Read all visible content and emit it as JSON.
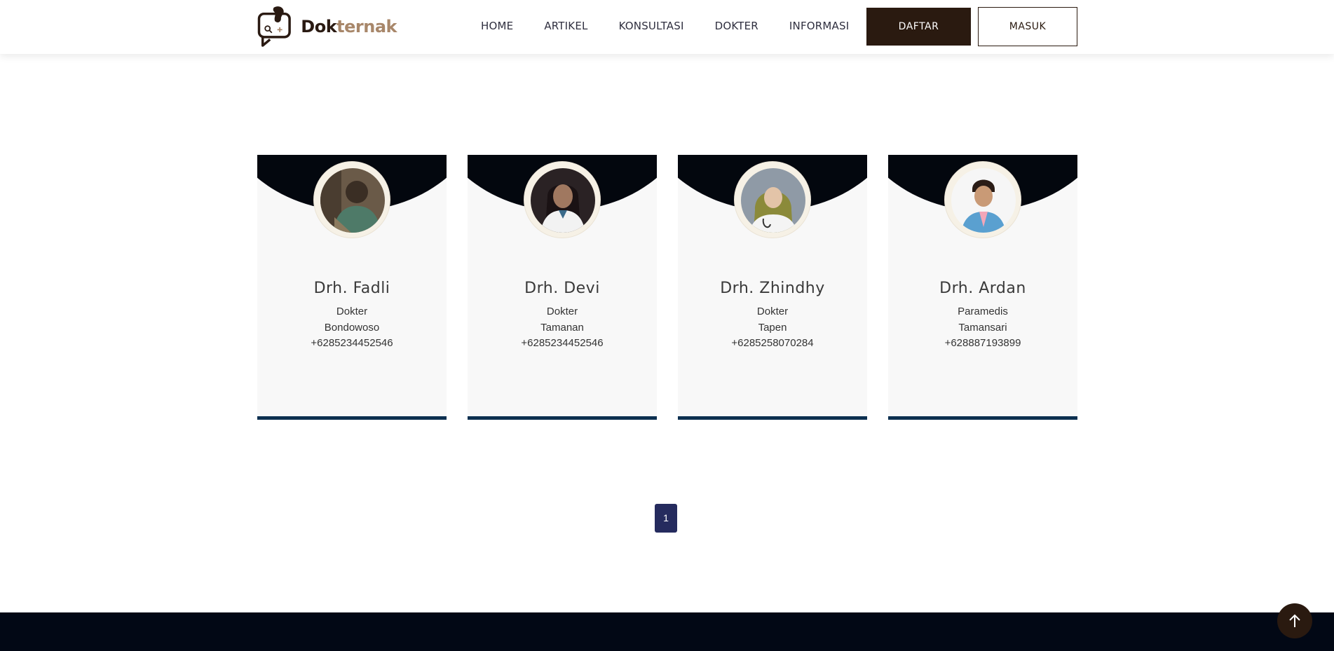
{
  "brand": {
    "part1": "Dok",
    "part2": "ternak"
  },
  "nav": {
    "items": [
      "HOME",
      "ARTIKEL",
      "KONSULTASI",
      "DOKTER",
      "INFORMASI"
    ]
  },
  "auth": {
    "register_label": "DAFTAR",
    "login_label": "MASUK"
  },
  "doctors": [
    {
      "name": "Drh. Fadli",
      "role": "Dokter",
      "city": "Bondowoso",
      "phone": "+6285234452546"
    },
    {
      "name": "Drh. Devi",
      "role": "Dokter",
      "city": "Tamanan",
      "phone": "+6285234452546"
    },
    {
      "name": "Drh. Zhindhy",
      "role": "Dokter",
      "city": "Tapen",
      "phone": "+6285258070284"
    },
    {
      "name": "Drh. Ardan",
      "role": "Paramedis",
      "city": "Tamansari",
      "phone": "+628887193899"
    }
  ],
  "pagination": {
    "current": "1"
  },
  "icons": {
    "logo": "dokternak-logo",
    "scroll_top": "arrow-up-icon"
  },
  "colors": {
    "primary": "#2a1a10",
    "accent": "#a8876a",
    "card_top": "#03070e",
    "card_border": "#0c3050",
    "pagination": "#252b5e"
  }
}
